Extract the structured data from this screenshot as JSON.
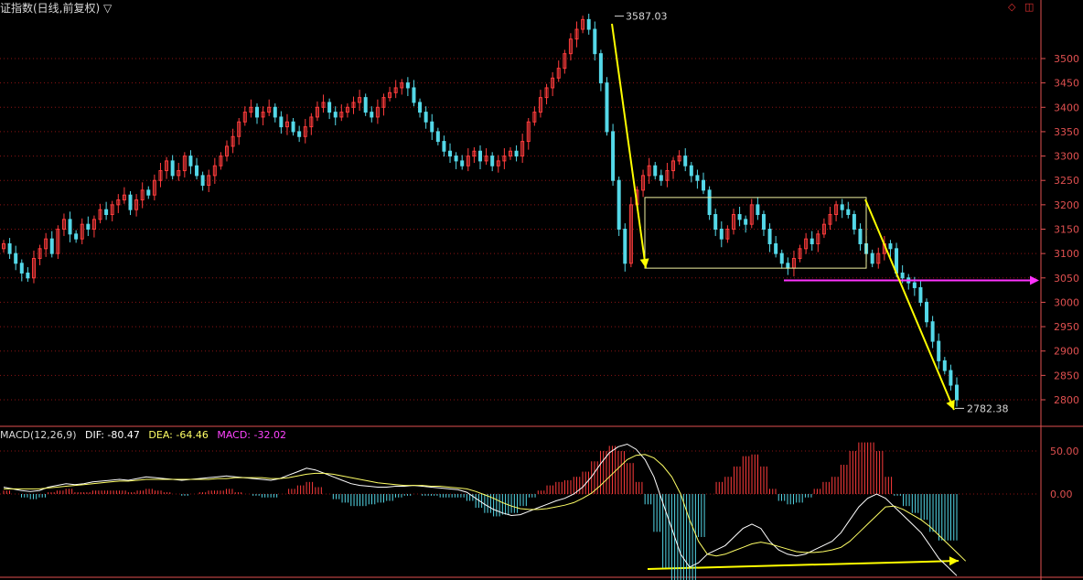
{
  "header": {
    "title": "证指数(日线,前复权) ▽",
    "corner_icons": [
      "diamond-icon",
      "window-icon"
    ]
  },
  "colors": {
    "up": "#ff3c3c",
    "down": "#54d8e8",
    "grid": "#8c1414",
    "axis_text": "#e05050",
    "arrow": "#ffff00",
    "box": "#f0f0a0",
    "support_line": "#ff33ff",
    "dif_line": "#ffffff",
    "dea_line": "#ffff66"
  },
  "macd_legend": {
    "name": "MACD(12,26,9)",
    "dif": "DIF: -80.47",
    "dea": "DEA: -64.46",
    "macd": "MACD: -32.02"
  },
  "chart_data": [
    {
      "type": "candlestick",
      "title": "证指数(日线,前复权)",
      "y_ticks": [
        "3500",
        "3450",
        "3400",
        "3350",
        "3300",
        "3250",
        "3200",
        "3150",
        "3100",
        "3050",
        "3000",
        "2950",
        "2900",
        "2850",
        "2800"
      ],
      "ylim": [
        2780,
        3600
      ],
      "grid": true,
      "annotations": {
        "high_label": "3587.03",
        "low_label": "2782.38",
        "high_value": 3587.03,
        "low_value": 2782.38,
        "consolidation_box": {
          "y_range": [
            3070,
            3215
          ]
        },
        "support_level": 3045
      },
      "close_series": [
        3120,
        3100,
        3080,
        3060,
        3050,
        3090,
        3110,
        3130,
        3100,
        3150,
        3170,
        3140,
        3130,
        3160,
        3150,
        3170,
        3190,
        3180,
        3200,
        3210,
        3220,
        3190,
        3210,
        3230,
        3220,
        3250,
        3270,
        3290,
        3260,
        3270,
        3300,
        3280,
        3260,
        3240,
        3260,
        3280,
        3300,
        3320,
        3340,
        3370,
        3390,
        3400,
        3380,
        3390,
        3400,
        3380,
        3360,
        3370,
        3350,
        3340,
        3360,
        3380,
        3400,
        3410,
        3390,
        3380,
        3390,
        3400,
        3410,
        3420,
        3390,
        3380,
        3400,
        3420,
        3430,
        3440,
        3450,
        3440,
        3410,
        3390,
        3370,
        3350,
        3330,
        3310,
        3300,
        3290,
        3280,
        3300,
        3310,
        3290,
        3300,
        3280,
        3290,
        3300,
        3310,
        3300,
        3330,
        3370,
        3390,
        3420,
        3440,
        3460,
        3480,
        3510,
        3540,
        3560,
        3580,
        3560,
        3510,
        3450,
        3350,
        3250,
        3150,
        3080,
        3200,
        3230,
        3260,
        3280,
        3260,
        3250,
        3270,
        3290,
        3300,
        3280,
        3260,
        3250,
        3230,
        3180,
        3150,
        3130,
        3150,
        3180,
        3170,
        3160,
        3200,
        3180,
        3150,
        3120,
        3100,
        3080,
        3070,
        3090,
        3110,
        3130,
        3120,
        3140,
        3160,
        3180,
        3200,
        3190,
        3180,
        3150,
        3120,
        3100,
        3080,
        3100,
        3120,
        3110,
        3060,
        3050,
        3040,
        3030,
        3000,
        2960,
        2920,
        2880,
        2860,
        2830,
        2800
      ]
    },
    {
      "type": "macd",
      "name": "MACD(12,26,9)",
      "y_ticks": [
        "50.00",
        "0.00"
      ],
      "last": {
        "DIF": -80.47,
        "DEA": -64.46,
        "MACD": -32.02
      },
      "dif_series": [
        8,
        6,
        4,
        3,
        4,
        8,
        10,
        12,
        11,
        12,
        14,
        15,
        16,
        17,
        16,
        18,
        20,
        19,
        18,
        17,
        16,
        17,
        18,
        19,
        20,
        21,
        20,
        19,
        18,
        17,
        16,
        18,
        22,
        26,
        30,
        28,
        24,
        20,
        16,
        12,
        10,
        9,
        8,
        8,
        9,
        9,
        10,
        9,
        8,
        7,
        6,
        5,
        2,
        -5,
        -12,
        -18,
        -22,
        -25,
        -24,
        -20,
        -16,
        -12,
        -8,
        -5,
        0,
        8,
        20,
        35,
        48,
        55,
        58,
        52,
        40,
        20,
        -10,
        -40,
        -70,
        -85,
        -80,
        -70,
        -65,
        -60,
        -50,
        -40,
        -35,
        -40,
        -55,
        -65,
        -70,
        -72,
        -70,
        -65,
        -60,
        -55,
        -45,
        -30,
        -15,
        -5,
        0,
        -5,
        -15,
        -25,
        -35,
        -45,
        -60,
        -75,
        -85,
        -95
      ],
      "dea_series": [
        6,
        6,
        6,
        6,
        6,
        7,
        8,
        9,
        10,
        11,
        12,
        13,
        14,
        15,
        15,
        16,
        17,
        17,
        17,
        17,
        17,
        17,
        17,
        17,
        18,
        18,
        19,
        19,
        19,
        19,
        18,
        18,
        19,
        21,
        23,
        24,
        24,
        23,
        21,
        19,
        17,
        15,
        13,
        12,
        11,
        10,
        10,
        10,
        9,
        9,
        8,
        7,
        6,
        3,
        -1,
        -5,
        -10,
        -14,
        -17,
        -18,
        -18,
        -17,
        -15,
        -13,
        -10,
        -5,
        1,
        10,
        20,
        30,
        40,
        45,
        46,
        42,
        33,
        20,
        0,
        -30,
        -55,
        -70,
        -72,
        -70,
        -66,
        -62,
        -58,
        -56,
        -58,
        -61,
        -64,
        -67,
        -68,
        -68,
        -67,
        -65,
        -62,
        -55,
        -45,
        -35,
        -25,
        -15,
        -14,
        -18,
        -24,
        -30,
        -38,
        -48,
        -58,
        -68,
        -78
      ]
    }
  ]
}
